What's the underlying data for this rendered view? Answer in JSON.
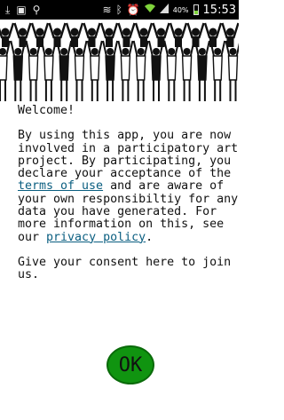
{
  "status_bar": {
    "battery_percent": "40%",
    "battery_level": 0.4,
    "time": "15:53",
    "icons": [
      "download-icon",
      "image-icon",
      "usb-icon",
      "vibrate-icon",
      "bluetooth-icon",
      "alarm-icon",
      "wifi-icon",
      "signal-icon",
      "battery-icon"
    ]
  },
  "welcome": "Welcome!",
  "consent_text": {
    "part1": "By using this app, you are now involved in a participatory art project. By participating, you declare your acceptance of the ",
    "terms_link": "terms of use",
    "part2": " and are aware of your own responsibiltiy for any data you have generated. For more information on this, see our ",
    "privacy_link": "privacy policy",
    "part3": "."
  },
  "prompt": "Give your consent here to join us.",
  "ok_button": "OK",
  "colors": {
    "ok_green": "#109410",
    "link": "#0a5e80"
  }
}
